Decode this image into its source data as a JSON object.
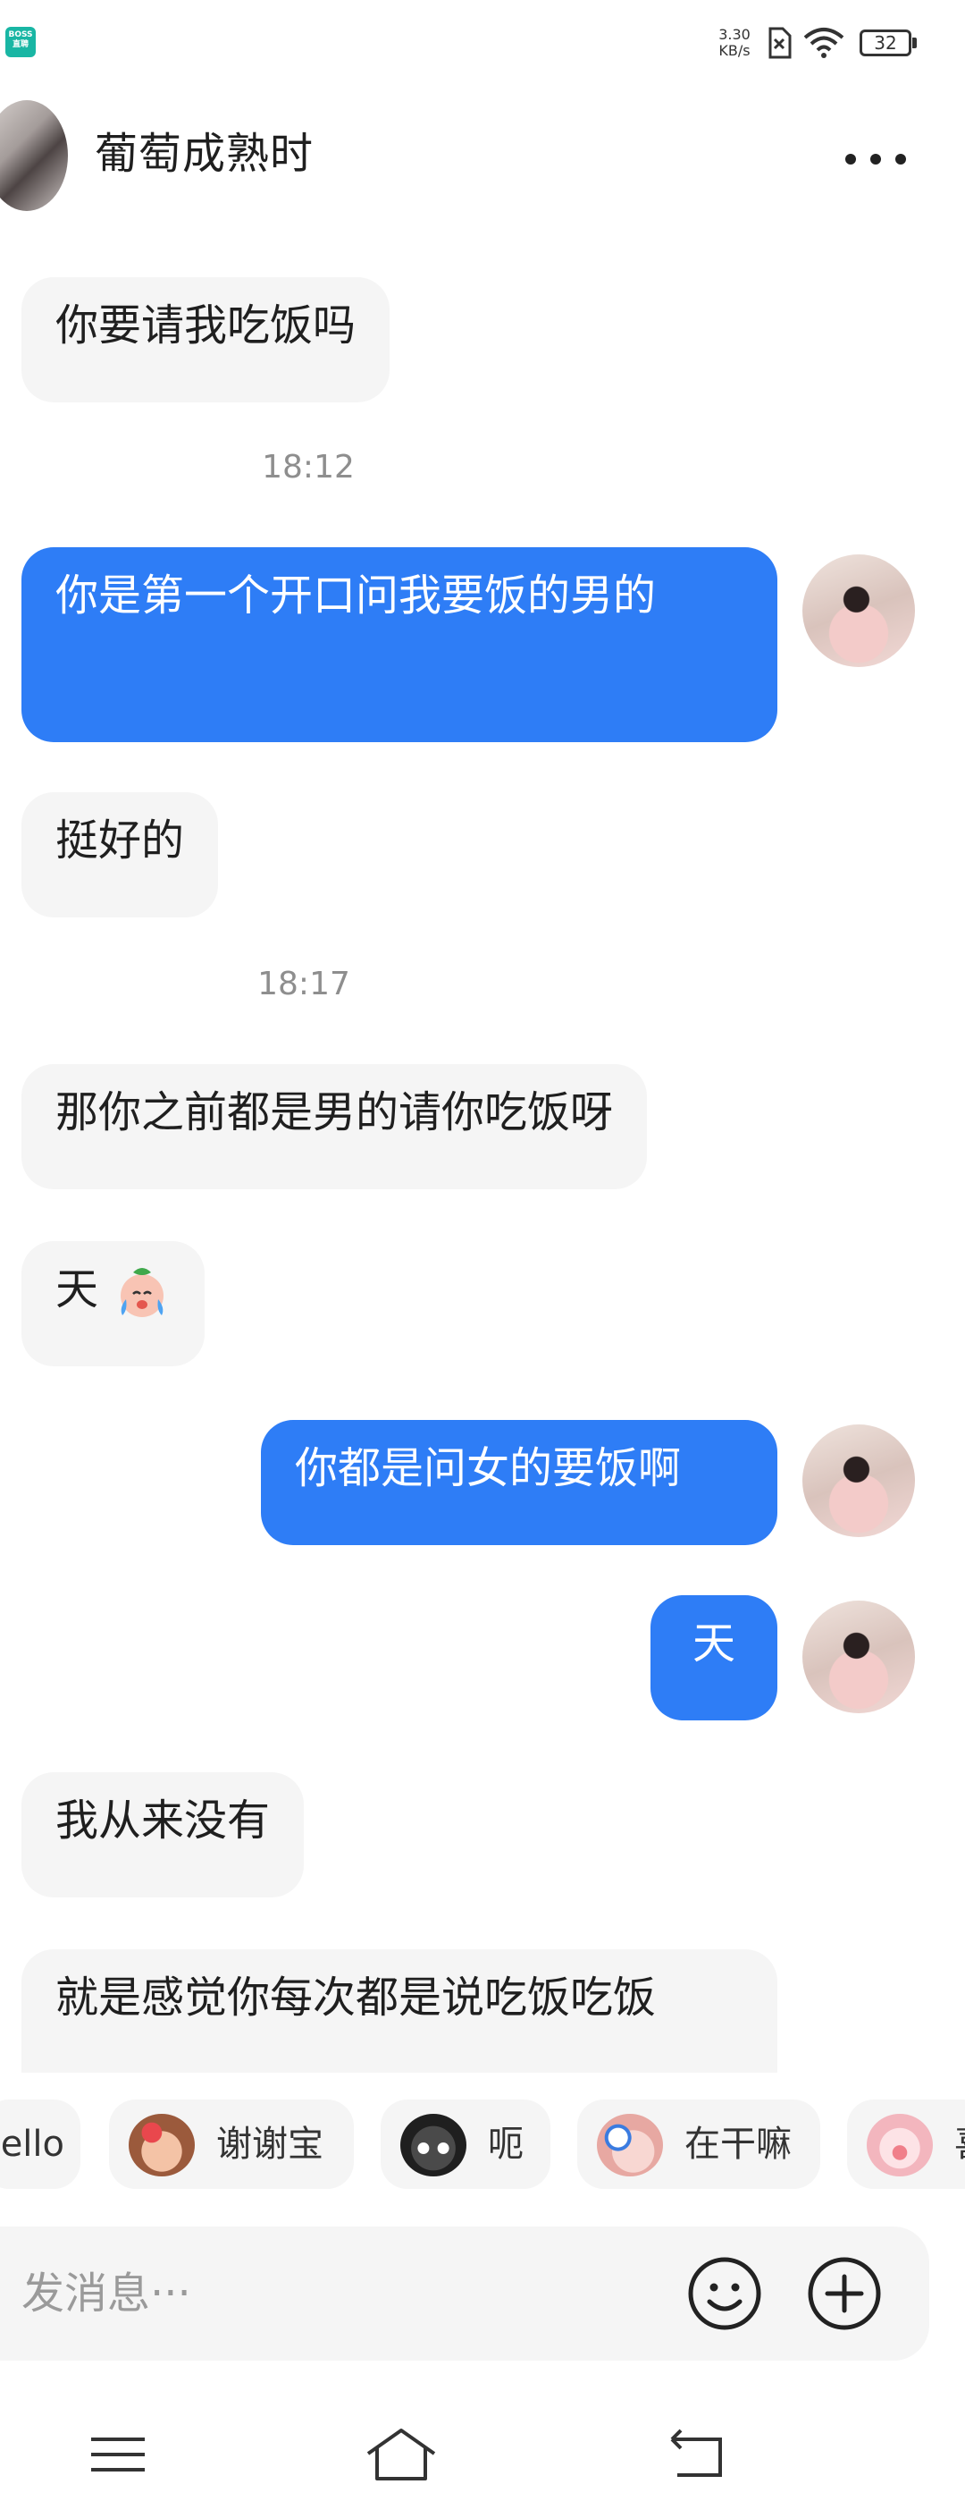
{
  "status_bar": {
    "app_badge_top": "BOSS",
    "app_badge_bottom": "直聘",
    "net_speed_value": "3.30",
    "net_speed_unit": "KB/s",
    "battery": "32",
    "icons": [
      "sim-no-service-icon",
      "wifi-icon",
      "battery-icon"
    ]
  },
  "header": {
    "contact_name": "葡萄成熟时",
    "more_icon": "more-dots-icon"
  },
  "messages": [
    {
      "side": "in",
      "text": "你要请我吃饭吗"
    },
    {
      "time": "18:12"
    },
    {
      "side": "out",
      "text": "你是第一个开口问我要饭的男的"
    },
    {
      "side": "in",
      "text": "挺好的"
    },
    {
      "time": "18:17"
    },
    {
      "side": "in",
      "text": "那你之前都是男的请你吃饭呀"
    },
    {
      "side": "in",
      "text": "天",
      "emoji": "crying-face-emoji"
    },
    {
      "side": "out",
      "text": "你都是问女的要饭啊"
    },
    {
      "side": "out",
      "text": "天"
    },
    {
      "side": "in",
      "text": "我从来没有"
    },
    {
      "side": "in",
      "text": "就是感觉你每次都是说吃饭吃饭"
    }
  ],
  "quick_replies": [
    {
      "label": "Hello",
      "icon": "hello-sticker"
    },
    {
      "label": "谢谢宝",
      "icon": "flower-girl-sticker"
    },
    {
      "label": "呃",
      "icon": "cat-sticker"
    },
    {
      "label": "在干嘛",
      "icon": "magnifier-sticker"
    },
    {
      "label": "喜",
      "icon": "pig-sticker"
    }
  ],
  "input": {
    "placeholder": "发消息···"
  },
  "nav": {
    "icons": [
      "menu-icon",
      "home-icon",
      "back-icon"
    ]
  },
  "colors": {
    "outgoing_bubble": "#2e7df6",
    "incoming_bubble": "#f5f5f5",
    "time_text": "#8e8e8e"
  }
}
